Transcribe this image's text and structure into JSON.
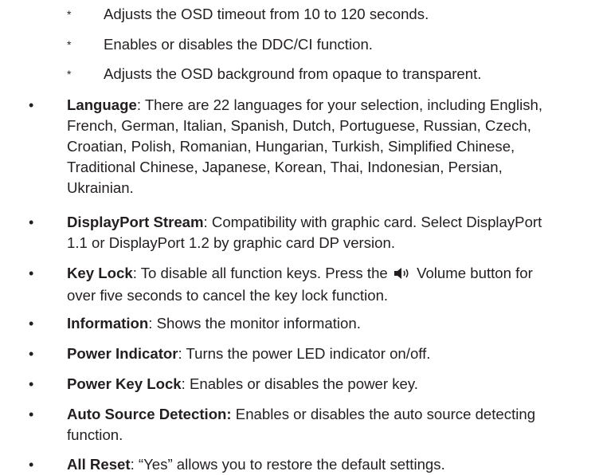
{
  "sub_items": [
    {
      "marker": "*",
      "text": "Adjusts the OSD timeout from 10 to 120 seconds."
    },
    {
      "marker": "*",
      "text": "Enables or disables the DDC/CI function."
    },
    {
      "marker": "*",
      "text": "Adjusts the OSD background from opaque to transparent."
    }
  ],
  "bullet_char": "•",
  "items": [
    {
      "term": "Language",
      "sep": ":",
      "lines": [
        " There are 22 languages for your selection, including English,",
        "French, German, Italian, Spanish, Dutch, Portuguese, Russian, Czech,",
        "Croatian, Polish, Romanian, Hungarian, Turkish, Simplified Chinese,",
        "Traditional Chinese, Japanese, Korean, Thai, Indonesian, Persian,",
        "Ukrainian."
      ]
    },
    {
      "term": "DisplayPort Stream",
      "sep": ":",
      "lines": [
        " Compatibility with graphic card. Select DisplayPort",
        "1.1 or DisplayPort 1.2 by graphic card DP version."
      ]
    },
    {
      "term": "Key Lock",
      "sep": ":",
      "line1_before_icon": " To disable all function keys. Press the ",
      "icon": "speaker-volume-icon",
      "line1_after_icon": " Volume button for",
      "line2": "over five seconds to cancel the key lock function."
    },
    {
      "term": "Information",
      "sep": ":",
      "lines": [
        " Shows the monitor information."
      ]
    },
    {
      "term": "Power Indicator",
      "sep": ":",
      "lines": [
        " Turns the power LED indicator on/off."
      ]
    },
    {
      "term": "Power Key Lock",
      "sep": ":",
      "lines": [
        " Enables or disables the power key."
      ]
    },
    {
      "term": "Auto Source Detection:",
      "sep": "",
      "lines": [
        " Enables or disables the auto source detecting",
        "function."
      ]
    },
    {
      "term": "All Reset",
      "sep": ":",
      "lines": [
        " “Yes” allows you to restore the default settings."
      ]
    }
  ]
}
